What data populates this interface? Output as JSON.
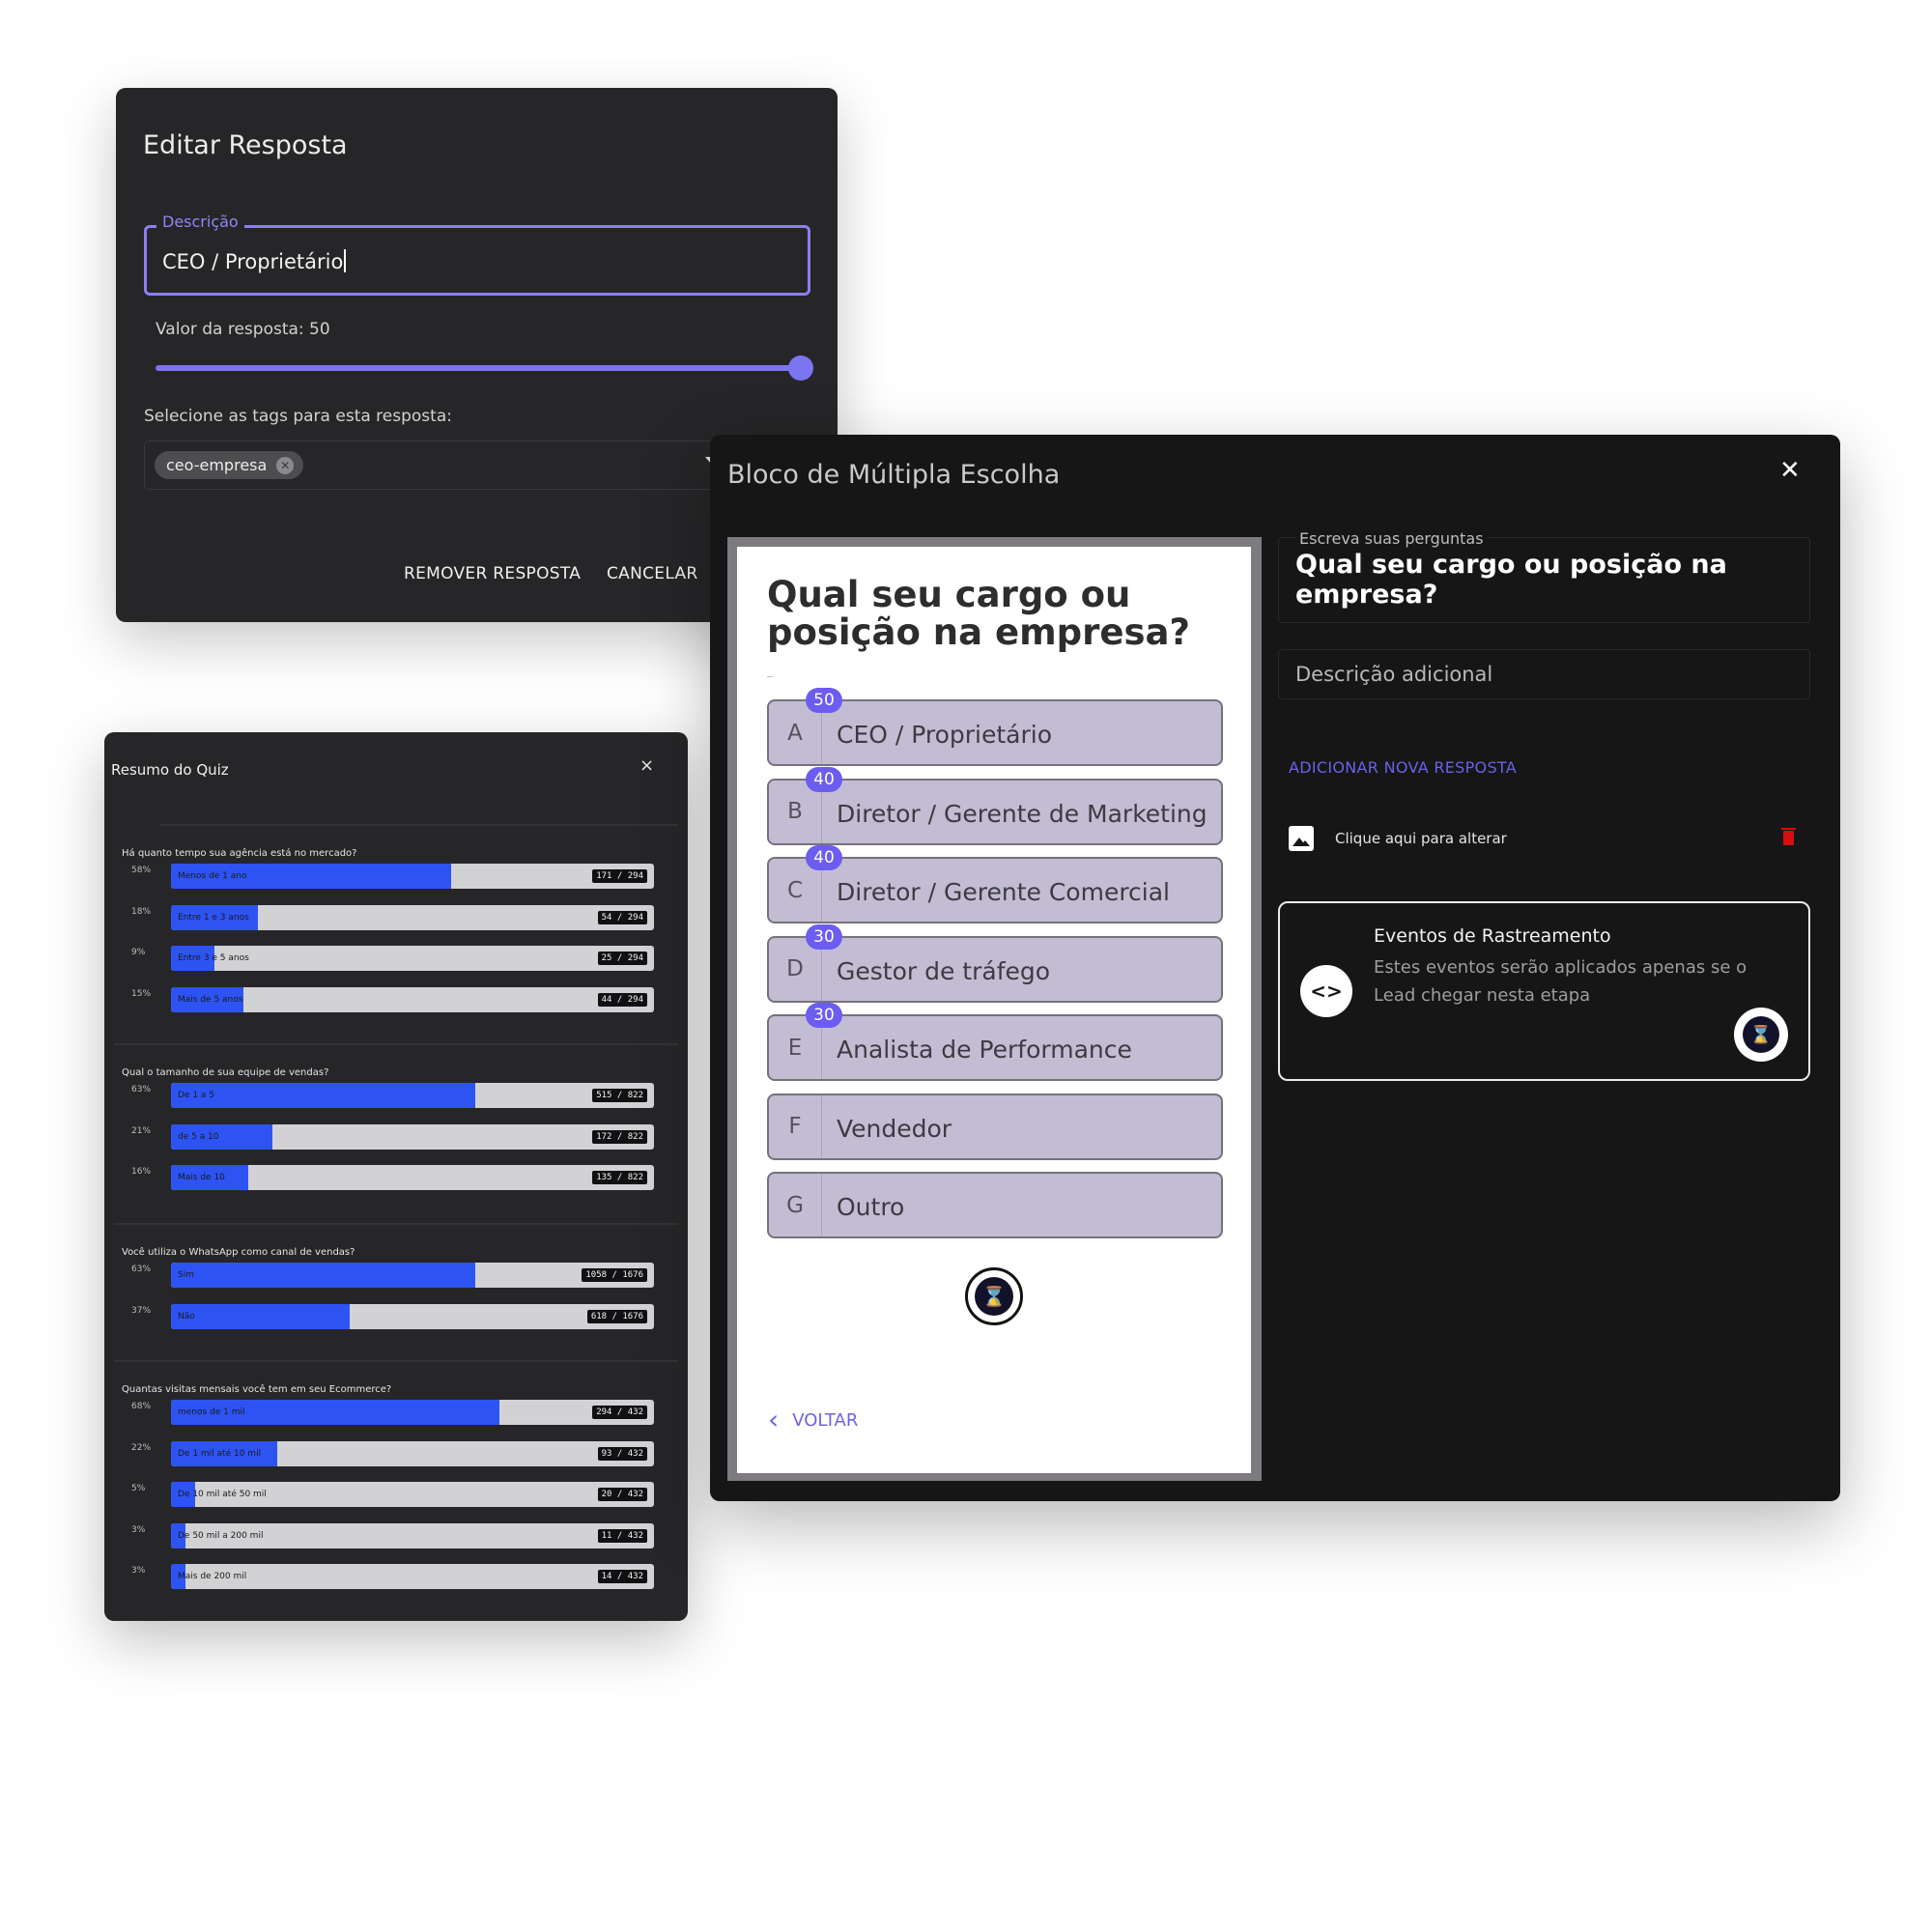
{
  "edit_dialog": {
    "title": "Editar Resposta",
    "description_label": "Descrição",
    "description_value": "CEO / Proprietário",
    "slider_label": "Valor da resposta: 50",
    "slider_value": 50,
    "tags_label": "Selecione as tags para esta resposta:",
    "tag_chip": "ceo-empresa",
    "remove_button": "REMOVER RESPOSTA",
    "cancel_button": "CANCELAR",
    "accent_color": "#7c74f0"
  },
  "quiz_summary": {
    "title": "Resumo do Quiz",
    "close": "×",
    "questions": [
      {
        "text": "Há quanto tempo sua agência está no mercado?",
        "options": [
          {
            "label": "Menos de 1 ano",
            "percent": "58%",
            "count": "171 / 294",
            "fraction": 0.58
          },
          {
            "label": "Entre 1 e 3 anos",
            "percent": "18%",
            "count": "54 / 294",
            "fraction": 0.18
          },
          {
            "label": "Entre 3 e 5 anos",
            "percent": "9%",
            "count": "25 / 294",
            "fraction": 0.09
          },
          {
            "label": "Mais de 5 anos",
            "percent": "15%",
            "count": "44 / 294",
            "fraction": 0.15
          }
        ]
      },
      {
        "text": "Qual o tamanho de sua equipe de vendas?",
        "options": [
          {
            "label": "De 1 a 5",
            "percent": "63%",
            "count": "515 / 822",
            "fraction": 0.63
          },
          {
            "label": "de 5 a 10",
            "percent": "21%",
            "count": "172 / 822",
            "fraction": 0.21
          },
          {
            "label": "Mais de 10",
            "percent": "16%",
            "count": "135 / 822",
            "fraction": 0.16
          }
        ]
      },
      {
        "text": "Você utiliza o WhatsApp como canal de vendas?",
        "options": [
          {
            "label": "Sim",
            "percent": "63%",
            "count": "1058 / 1676",
            "fraction": 0.63
          },
          {
            "label": "Não",
            "percent": "37%",
            "count": "618 / 1676",
            "fraction": 0.37
          }
        ]
      },
      {
        "text": "Quantas visitas mensais você tem em seu Ecommerce?",
        "options": [
          {
            "label": "menos de 1 mil",
            "percent": "68%",
            "count": "294 / 432",
            "fraction": 0.68
          },
          {
            "label": "De 1 mil até 10 mil",
            "percent": "22%",
            "count": "93 / 432",
            "fraction": 0.22
          },
          {
            "label": "De 10 mil até 50 mil",
            "percent": "5%",
            "count": "20 / 432",
            "fraction": 0.05
          },
          {
            "label": "De 50 mil a 200 mil",
            "percent": "3%",
            "count": "11 / 432",
            "fraction": 0.03
          },
          {
            "label": "Mais de 200 mil",
            "percent": "3%",
            "count": "14 / 432",
            "fraction": 0.03
          }
        ]
      }
    ],
    "bar_color": "#2d54f3"
  },
  "mc_block": {
    "title": "Bloco de Múltipla Escolha",
    "close": "✕",
    "preview": {
      "question": "Qual seu cargo ou posição na empresa?",
      "answers": [
        {
          "letter": "A",
          "text": "CEO / Proprietário",
          "value": "50"
        },
        {
          "letter": "B",
          "text": "Diretor / Gerente de Marketing",
          "value": "40"
        },
        {
          "letter": "C",
          "text": "Diretor / Gerente Comercial",
          "value": "40"
        },
        {
          "letter": "D",
          "text": "Gestor de tráfego",
          "value": "30"
        },
        {
          "letter": "E",
          "text": "Analista de Performance",
          "value": "30"
        },
        {
          "letter": "F",
          "text": "Vendedor",
          "value": ""
        },
        {
          "letter": "G",
          "text": "Outro",
          "value": ""
        }
      ],
      "back": "VOLTAR"
    },
    "editor": {
      "question_label": "Escreva suas perguntas",
      "question_value": "Qual seu cargo ou posição na empresa?",
      "description_placeholder": "Descrição adicional",
      "add_answer": "ADICIONAR NOVA RESPOSTA",
      "image_text": "Clique aqui para alterar",
      "tracking_title": "Eventos de Rastreamento",
      "tracking_desc": "Estes eventos serão aplicados apenas se o Lead chegar nesta etapa"
    }
  }
}
